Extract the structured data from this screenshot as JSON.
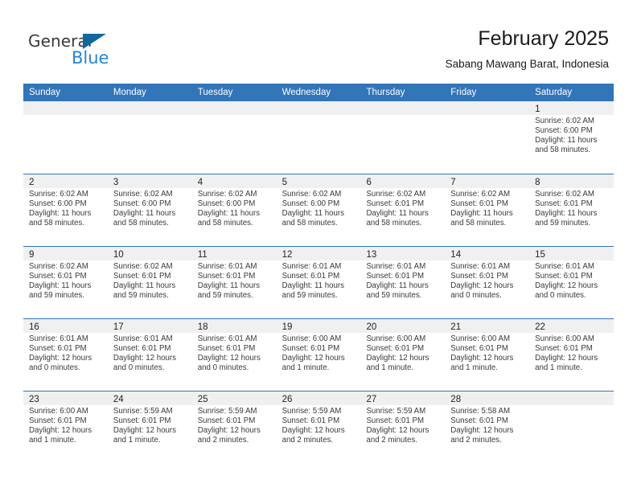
{
  "brand": {
    "name_part1": "General",
    "name_part2": "Blue",
    "triangle_color": "#11689e",
    "blue_color": "#2585d3"
  },
  "header": {
    "title": "February 2025",
    "subtitle": "Sabang Mawang Barat, Indonesia",
    "header_bg": "#3275b9",
    "day_band_bg": "#f0f0f0"
  },
  "weekdays": [
    "Sunday",
    "Monday",
    "Tuesday",
    "Wednesday",
    "Thursday",
    "Friday",
    "Saturday"
  ],
  "weeks": [
    [
      {
        "day": "",
        "sunrise": "",
        "sunset": "",
        "daylight": "",
        "empty": true
      },
      {
        "day": "",
        "sunrise": "",
        "sunset": "",
        "daylight": "",
        "empty": true
      },
      {
        "day": "",
        "sunrise": "",
        "sunset": "",
        "daylight": "",
        "empty": true
      },
      {
        "day": "",
        "sunrise": "",
        "sunset": "",
        "daylight": "",
        "empty": true
      },
      {
        "day": "",
        "sunrise": "",
        "sunset": "",
        "daylight": "",
        "empty": true
      },
      {
        "day": "",
        "sunrise": "",
        "sunset": "",
        "daylight": "",
        "empty": true
      },
      {
        "day": "1",
        "sunrise": "Sunrise: 6:02 AM",
        "sunset": "Sunset: 6:00 PM",
        "daylight": "Daylight: 11 hours and 58 minutes.",
        "empty": false
      }
    ],
    [
      {
        "day": "2",
        "sunrise": "Sunrise: 6:02 AM",
        "sunset": "Sunset: 6:00 PM",
        "daylight": "Daylight: 11 hours and 58 minutes.",
        "empty": false
      },
      {
        "day": "3",
        "sunrise": "Sunrise: 6:02 AM",
        "sunset": "Sunset: 6:00 PM",
        "daylight": "Daylight: 11 hours and 58 minutes.",
        "empty": false
      },
      {
        "day": "4",
        "sunrise": "Sunrise: 6:02 AM",
        "sunset": "Sunset: 6:00 PM",
        "daylight": "Daylight: 11 hours and 58 minutes.",
        "empty": false
      },
      {
        "day": "5",
        "sunrise": "Sunrise: 6:02 AM",
        "sunset": "Sunset: 6:00 PM",
        "daylight": "Daylight: 11 hours and 58 minutes.",
        "empty": false
      },
      {
        "day": "6",
        "sunrise": "Sunrise: 6:02 AM",
        "sunset": "Sunset: 6:01 PM",
        "daylight": "Daylight: 11 hours and 58 minutes.",
        "empty": false
      },
      {
        "day": "7",
        "sunrise": "Sunrise: 6:02 AM",
        "sunset": "Sunset: 6:01 PM",
        "daylight": "Daylight: 11 hours and 58 minutes.",
        "empty": false
      },
      {
        "day": "8",
        "sunrise": "Sunrise: 6:02 AM",
        "sunset": "Sunset: 6:01 PM",
        "daylight": "Daylight: 11 hours and 59 minutes.",
        "empty": false
      }
    ],
    [
      {
        "day": "9",
        "sunrise": "Sunrise: 6:02 AM",
        "sunset": "Sunset: 6:01 PM",
        "daylight": "Daylight: 11 hours and 59 minutes.",
        "empty": false
      },
      {
        "day": "10",
        "sunrise": "Sunrise: 6:02 AM",
        "sunset": "Sunset: 6:01 PM",
        "daylight": "Daylight: 11 hours and 59 minutes.",
        "empty": false
      },
      {
        "day": "11",
        "sunrise": "Sunrise: 6:01 AM",
        "sunset": "Sunset: 6:01 PM",
        "daylight": "Daylight: 11 hours and 59 minutes.",
        "empty": false
      },
      {
        "day": "12",
        "sunrise": "Sunrise: 6:01 AM",
        "sunset": "Sunset: 6:01 PM",
        "daylight": "Daylight: 11 hours and 59 minutes.",
        "empty": false
      },
      {
        "day": "13",
        "sunrise": "Sunrise: 6:01 AM",
        "sunset": "Sunset: 6:01 PM",
        "daylight": "Daylight: 11 hours and 59 minutes.",
        "empty": false
      },
      {
        "day": "14",
        "sunrise": "Sunrise: 6:01 AM",
        "sunset": "Sunset: 6:01 PM",
        "daylight": "Daylight: 12 hours and 0 minutes.",
        "empty": false
      },
      {
        "day": "15",
        "sunrise": "Sunrise: 6:01 AM",
        "sunset": "Sunset: 6:01 PM",
        "daylight": "Daylight: 12 hours and 0 minutes.",
        "empty": false
      }
    ],
    [
      {
        "day": "16",
        "sunrise": "Sunrise: 6:01 AM",
        "sunset": "Sunset: 6:01 PM",
        "daylight": "Daylight: 12 hours and 0 minutes.",
        "empty": false
      },
      {
        "day": "17",
        "sunrise": "Sunrise: 6:01 AM",
        "sunset": "Sunset: 6:01 PM",
        "daylight": "Daylight: 12 hours and 0 minutes.",
        "empty": false
      },
      {
        "day": "18",
        "sunrise": "Sunrise: 6:01 AM",
        "sunset": "Sunset: 6:01 PM",
        "daylight": "Daylight: 12 hours and 0 minutes.",
        "empty": false
      },
      {
        "day": "19",
        "sunrise": "Sunrise: 6:00 AM",
        "sunset": "Sunset: 6:01 PM",
        "daylight": "Daylight: 12 hours and 1 minute.",
        "empty": false
      },
      {
        "day": "20",
        "sunrise": "Sunrise: 6:00 AM",
        "sunset": "Sunset: 6:01 PM",
        "daylight": "Daylight: 12 hours and 1 minute.",
        "empty": false
      },
      {
        "day": "21",
        "sunrise": "Sunrise: 6:00 AM",
        "sunset": "Sunset: 6:01 PM",
        "daylight": "Daylight: 12 hours and 1 minute.",
        "empty": false
      },
      {
        "day": "22",
        "sunrise": "Sunrise: 6:00 AM",
        "sunset": "Sunset: 6:01 PM",
        "daylight": "Daylight: 12 hours and 1 minute.",
        "empty": false
      }
    ],
    [
      {
        "day": "23",
        "sunrise": "Sunrise: 6:00 AM",
        "sunset": "Sunset: 6:01 PM",
        "daylight": "Daylight: 12 hours and 1 minute.",
        "empty": false
      },
      {
        "day": "24",
        "sunrise": "Sunrise: 5:59 AM",
        "sunset": "Sunset: 6:01 PM",
        "daylight": "Daylight: 12 hours and 1 minute.",
        "empty": false
      },
      {
        "day": "25",
        "sunrise": "Sunrise: 5:59 AM",
        "sunset": "Sunset: 6:01 PM",
        "daylight": "Daylight: 12 hours and 2 minutes.",
        "empty": false
      },
      {
        "day": "26",
        "sunrise": "Sunrise: 5:59 AM",
        "sunset": "Sunset: 6:01 PM",
        "daylight": "Daylight: 12 hours and 2 minutes.",
        "empty": false
      },
      {
        "day": "27",
        "sunrise": "Sunrise: 5:59 AM",
        "sunset": "Sunset: 6:01 PM",
        "daylight": "Daylight: 12 hours and 2 minutes.",
        "empty": false
      },
      {
        "day": "28",
        "sunrise": "Sunrise: 5:58 AM",
        "sunset": "Sunset: 6:01 PM",
        "daylight": "Daylight: 12 hours and 2 minutes.",
        "empty": false
      },
      {
        "day": "",
        "sunrise": "",
        "sunset": "",
        "daylight": "",
        "empty": true
      }
    ]
  ]
}
